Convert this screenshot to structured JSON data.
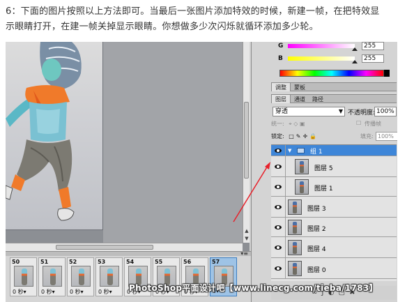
{
  "instruction": {
    "line1": "6：下面的图片按照以上方法即可。当最后一张图片添加特效的时候，新建一帧，在把特效显",
    "line2": "示眼睛打开，在建一帧关掉显示眼睛。你想做多少次闪烁就循环添加多少轮。"
  },
  "color_panel": {
    "g_label": "G",
    "g_value": "255",
    "b_label": "B",
    "b_value": "255"
  },
  "panel_tabs": {
    "top": [
      "调整",
      "蒙板"
    ],
    "layers_tabs": [
      "图层",
      "通道",
      "路径"
    ]
  },
  "blend": {
    "mode": "穿透",
    "opacity_label": "不透明度:",
    "opacity_value": "100%",
    "unify_label": "统一:",
    "propagate_label": "传播帧",
    "lock_label": "锁定:",
    "fill_label": "填充:",
    "fill_value": "100%"
  },
  "layers": [
    {
      "name": "组 1",
      "type": "group"
    },
    {
      "name": "图层 5",
      "type": "layer"
    },
    {
      "name": "图层 1",
      "type": "layer"
    },
    {
      "name": "图层 3",
      "type": "layer"
    },
    {
      "name": "图层 2",
      "type": "layer"
    },
    {
      "name": "图层 4",
      "type": "layer"
    },
    {
      "name": "图层 0",
      "type": "layer"
    }
  ],
  "frames": [
    {
      "num": "50",
      "delay": "0 秒"
    },
    {
      "num": "51",
      "delay": "0 秒"
    },
    {
      "num": "52",
      "delay": "0 秒"
    },
    {
      "num": "53",
      "delay": "0 秒"
    },
    {
      "num": "54",
      "delay": "0 秒"
    },
    {
      "num": "55",
      "delay": "0 秒"
    },
    {
      "num": "56",
      "delay": "0 秒"
    },
    {
      "num": "57",
      "delay": "0",
      "selected": true
    }
  ],
  "watermark": "PhotoShop平面设计吧【www.linecg.com/tieba/1783】",
  "colors": {
    "selected_layer": "#3e86d8",
    "arrow": "#e8202a",
    "g_slider": "#c000c0",
    "b_slider": "#e0e000"
  }
}
